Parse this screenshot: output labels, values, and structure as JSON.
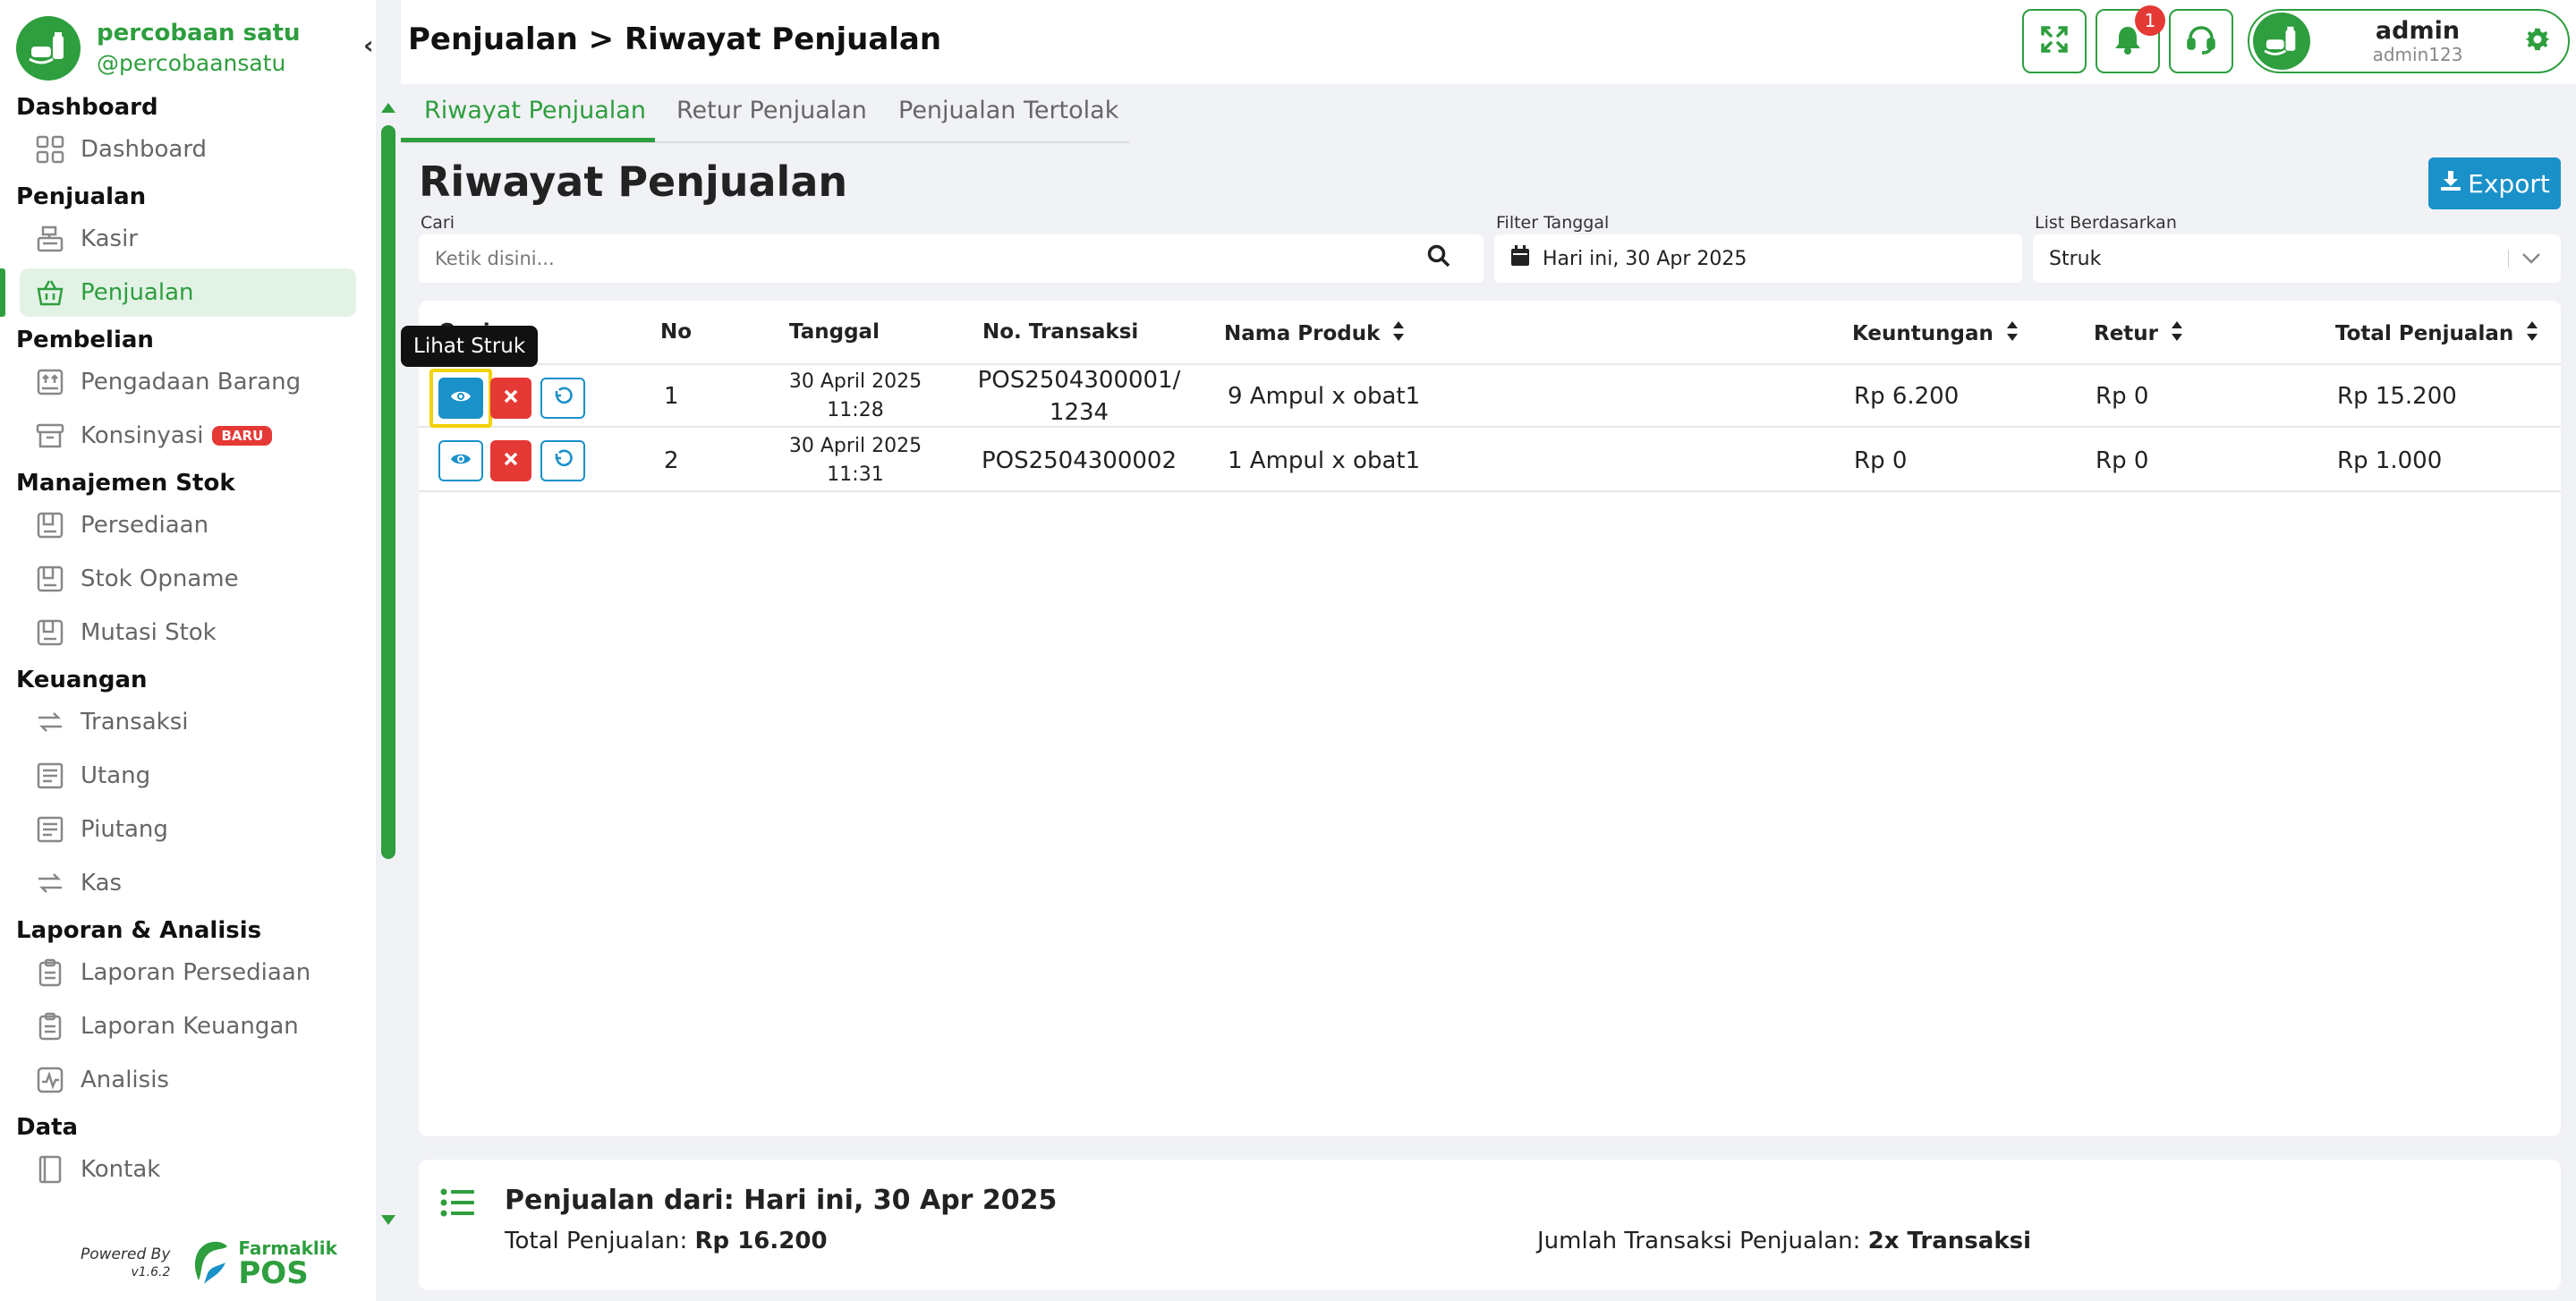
{
  "brand": {
    "name": "percobaan satu",
    "handle": "@percobaansatu"
  },
  "sidebar": {
    "sections": [
      {
        "title": "Dashboard",
        "items": [
          {
            "label": "Dashboard",
            "icon": "grid-icon"
          }
        ]
      },
      {
        "title": "Penjualan",
        "items": [
          {
            "label": "Kasir",
            "icon": "cash-register-icon"
          },
          {
            "label": "Penjualan",
            "icon": "basket-icon",
            "active": true
          }
        ]
      },
      {
        "title": "Pembelian",
        "items": [
          {
            "label": "Pengadaan Barang",
            "icon": "box-up-icon"
          },
          {
            "label": "Konsinyasi",
            "icon": "archive-icon",
            "badge": "BARU"
          }
        ]
      },
      {
        "title": "Manajemen Stok",
        "items": [
          {
            "label": "Persediaan",
            "icon": "stock-icon"
          },
          {
            "label": "Stok Opname",
            "icon": "stock-icon"
          },
          {
            "label": "Mutasi Stok",
            "icon": "stock-icon"
          }
        ]
      },
      {
        "title": "Keuangan",
        "items": [
          {
            "label": "Transaksi",
            "icon": "transfer-icon"
          },
          {
            "label": "Utang",
            "icon": "ledger-icon"
          },
          {
            "label": "Piutang",
            "icon": "ledger-icon"
          },
          {
            "label": "Kas",
            "icon": "transfer-icon"
          }
        ]
      },
      {
        "title": "Laporan & Analisis",
        "items": [
          {
            "label": "Laporan Persediaan",
            "icon": "clipboard-icon"
          },
          {
            "label": "Laporan Keuangan",
            "icon": "clipboard-icon"
          },
          {
            "label": "Analisis",
            "icon": "pulse-chart-icon"
          }
        ]
      },
      {
        "title": "Data",
        "items": [
          {
            "label": "Kontak",
            "icon": "contact-book-icon"
          }
        ]
      }
    ],
    "powered_by": "Powered By",
    "version": "v1.6.2",
    "pos_brand_top": "Farmaklik",
    "pos_brand_bottom": "POS"
  },
  "header": {
    "breadcrumb": "Penjualan > Riwayat Penjualan",
    "notification_count": "1",
    "user": {
      "name": "admin",
      "username": "admin123"
    }
  },
  "tabs": [
    "Riwayat Penjualan",
    "Retur Penjualan",
    "Penjualan Tertolak"
  ],
  "main": {
    "title": "Riwayat Penjualan",
    "export_label": "Export",
    "filters": {
      "search_label": "Cari",
      "search_placeholder": "Ketik disini...",
      "date_label": "Filter Tanggal",
      "date_value": "Hari ini, 30 Apr 2025",
      "list_label": "List Berdasarkan",
      "list_value": "Struk"
    },
    "tooltip": "Lihat Struk",
    "columns": {
      "action": "Opsi",
      "no": "No",
      "date": "Tanggal",
      "trx": "No. Transaksi",
      "product": "Nama Produk",
      "profit": "Keuntungan",
      "return": "Retur",
      "total": "Total Penjualan"
    },
    "rows": [
      {
        "no": "1",
        "date": "30 April 2025",
        "time": "11:28",
        "trx_line1": "POS2504300001/",
        "trx_line2": "1234",
        "product": "9 Ampul x obat1",
        "profit": "Rp 6.200",
        "return": "Rp 0",
        "total": "Rp 15.200"
      },
      {
        "no": "2",
        "date": "30 April 2025",
        "time": "11:31",
        "trx_line1": "POS2504300002",
        "trx_line2": "",
        "product": "1 Ampul x obat1",
        "profit": "Rp 0",
        "return": "Rp 0",
        "total": "Rp 1.000"
      }
    ]
  },
  "summary": {
    "title": "Penjualan dari: Hari ini, 30 Apr 2025",
    "total_label": "Total Penjualan: ",
    "total_value": "Rp 16.200",
    "count_label": "Jumlah Transaksi Penjualan: ",
    "count_value": "2x Transaksi"
  },
  "colors": {
    "brand_green": "#2e9e3e",
    "action_blue": "#1a91c9",
    "danger_red": "#e53935",
    "highlight_yellow": "#f2d200"
  }
}
